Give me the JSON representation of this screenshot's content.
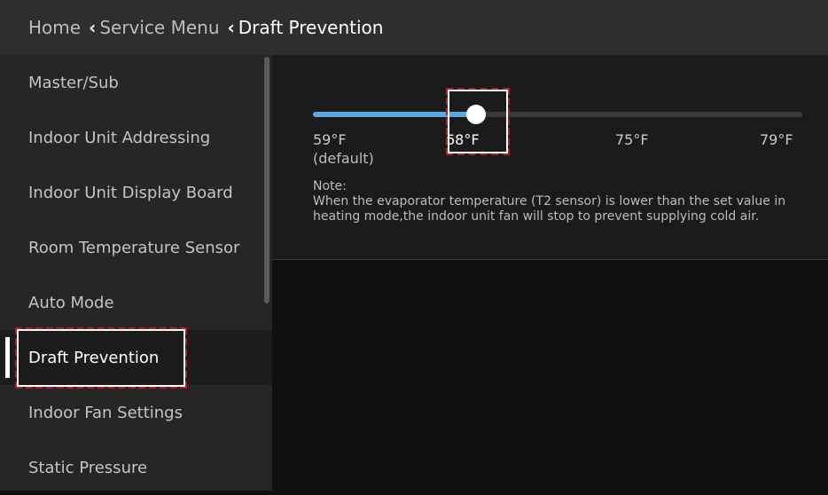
{
  "breadcrumb": {
    "home": "Home",
    "service_menu": "Service Menu",
    "current": "Draft Prevention"
  },
  "sidebar": {
    "items": [
      {
        "label": "Master/Sub"
      },
      {
        "label": "Indoor Unit Addressing"
      },
      {
        "label": "Indoor Unit Display Board"
      },
      {
        "label": "Room Temperature Sensor"
      },
      {
        "label": "Auto Mode"
      },
      {
        "label": "Draft Prevention",
        "selected": true
      },
      {
        "label": "Indoor Fan Settings"
      },
      {
        "label": "Static Pressure"
      }
    ]
  },
  "slider": {
    "options": [
      "59°F",
      "68°F",
      "75°F",
      "79°F"
    ],
    "default_label": "(default)",
    "selected": "68°F",
    "selected_fraction": 0.333,
    "fill_color": "#5aa8e0"
  },
  "note": {
    "title": "Note:",
    "text": "When the evaporator temperature (T2 sensor) is lower than the set value in heating mode,the indoor unit fan will stop to prevent supplying cold air."
  },
  "colors": {
    "annotation_box": "#b01e2a",
    "header_bg": "#2e2e2e",
    "sidebar_bg": "#262626"
  }
}
